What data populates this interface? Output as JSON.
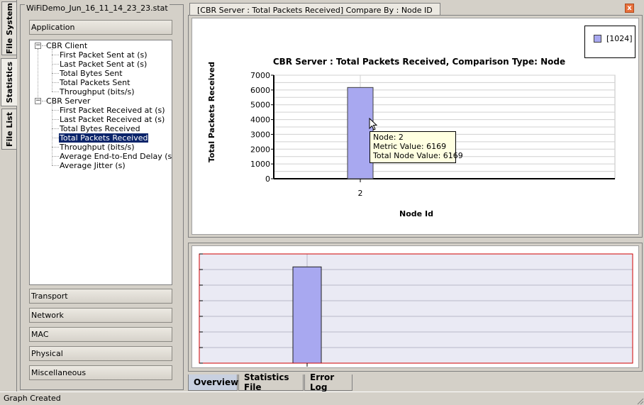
{
  "side_tabs": [
    {
      "label": "File System"
    },
    {
      "label": "Statistics"
    },
    {
      "label": "File List"
    }
  ],
  "left_panel": {
    "title": "WiFiDemo_Jun_16_11_14_23_23.stat",
    "categories_top": [
      {
        "label": "Application"
      }
    ],
    "categories_bottom": [
      {
        "label": "Transport"
      },
      {
        "label": "Network"
      },
      {
        "label": "MAC"
      },
      {
        "label": "Physical"
      },
      {
        "label": "Miscellaneous"
      }
    ],
    "tree": {
      "groups": [
        {
          "label": "CBR Client",
          "toggle": "−",
          "items": [
            "First Packet Sent at (s)",
            "Last Packet Sent at (s)",
            "Total Bytes Sent",
            "Total Packets Sent",
            "Throughput (bits/s)"
          ]
        },
        {
          "label": "CBR Server",
          "toggle": "−",
          "items": [
            "First Packet Received at (s)",
            "Last Packet Received at (s)",
            "Total Bytes Received",
            "Total Packets Received",
            "Throughput (bits/s)",
            "Average End-to-End Delay (s)",
            "Average Jitter (s)"
          ]
        }
      ],
      "selected": "Total Packets Received"
    }
  },
  "main_tab": {
    "label": "[CBR Server :  Total Packets Received] Compare By : Node ID",
    "close_symbol": "x"
  },
  "chart_data": {
    "type": "bar",
    "title": "CBR Server :  Total Packets Received, Comparison Type: Node",
    "xlabel": "Node Id",
    "ylabel": "Total Packets Received",
    "categories": [
      "2"
    ],
    "series": [
      {
        "name": "[1024]",
        "values": [
          6169
        ]
      }
    ],
    "ylim": [
      0,
      7000
    ],
    "yticks": [
      "0",
      "1000",
      "2000",
      "3000",
      "4000",
      "5000",
      "6000",
      "7000"
    ],
    "grid": true,
    "legend": "top-right",
    "bar_color": "#a8a8f0"
  },
  "tooltip": {
    "lines": [
      "Node: 2",
      "Metric Value: 6169",
      "Total Node Value: 6169"
    ]
  },
  "bottom_tabs": [
    {
      "label": "Overview",
      "active": true
    },
    {
      "label": "Statistics File",
      "active": false
    },
    {
      "label": "Error Log",
      "active": false
    }
  ],
  "status": {
    "text": "Graph Created"
  }
}
